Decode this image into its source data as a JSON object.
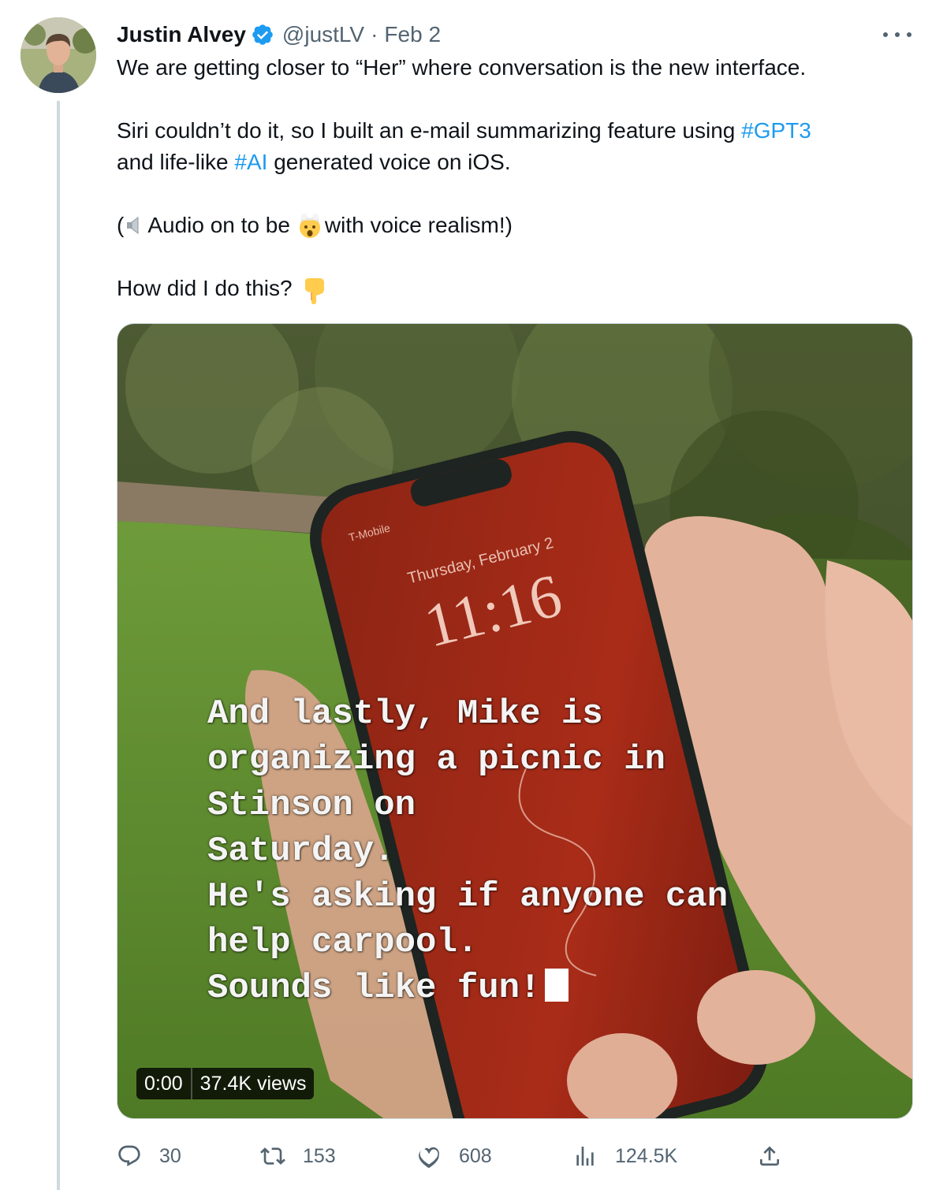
{
  "author": {
    "display_name": "Justin Alvey",
    "handle": "@justLV",
    "separator": "·",
    "date": "Feb 2"
  },
  "tweet": {
    "line1": "We are getting closer to “Her” where conversation is the new interface.",
    "line2_before": "Siri couldn’t do it, so I built an e-mail summarizing feature using ",
    "hashtag1": "#GPT3",
    "line3_before": "and life-like ",
    "hashtag2": "#AI",
    "line3_after": " generated voice on iOS.",
    "line4_open": "(",
    "line4_mid": "Audio on to be",
    "line4_after": "with voice realism!)",
    "line5": "How did I do this?"
  },
  "media": {
    "phone_date": "Thursday, February 2",
    "phone_time": "11:16",
    "phone_carrier": "T-Mobile",
    "caption_lines": [
      "And lastly, Mike is",
      "organizing a picnic in",
      "Stinson on",
      "Saturday.",
      "He's asking if anyone can",
      "help carpool.",
      "Sounds like fun!"
    ],
    "video_time": "0:00",
    "video_views": "37.4K views"
  },
  "actions": {
    "replies": "30",
    "retweets": "153",
    "likes": "608",
    "views": "124.5K"
  },
  "colors": {
    "accent": "#1d9bf0",
    "secondary_text": "#536471",
    "thread_line": "#cfd9de"
  },
  "icons": [
    "verified-badge-icon",
    "more-icon",
    "speaker-icon",
    "exploding-head-icon",
    "pointing-down-icon",
    "reply-icon",
    "retweet-icon",
    "like-icon",
    "views-icon",
    "share-icon"
  ]
}
